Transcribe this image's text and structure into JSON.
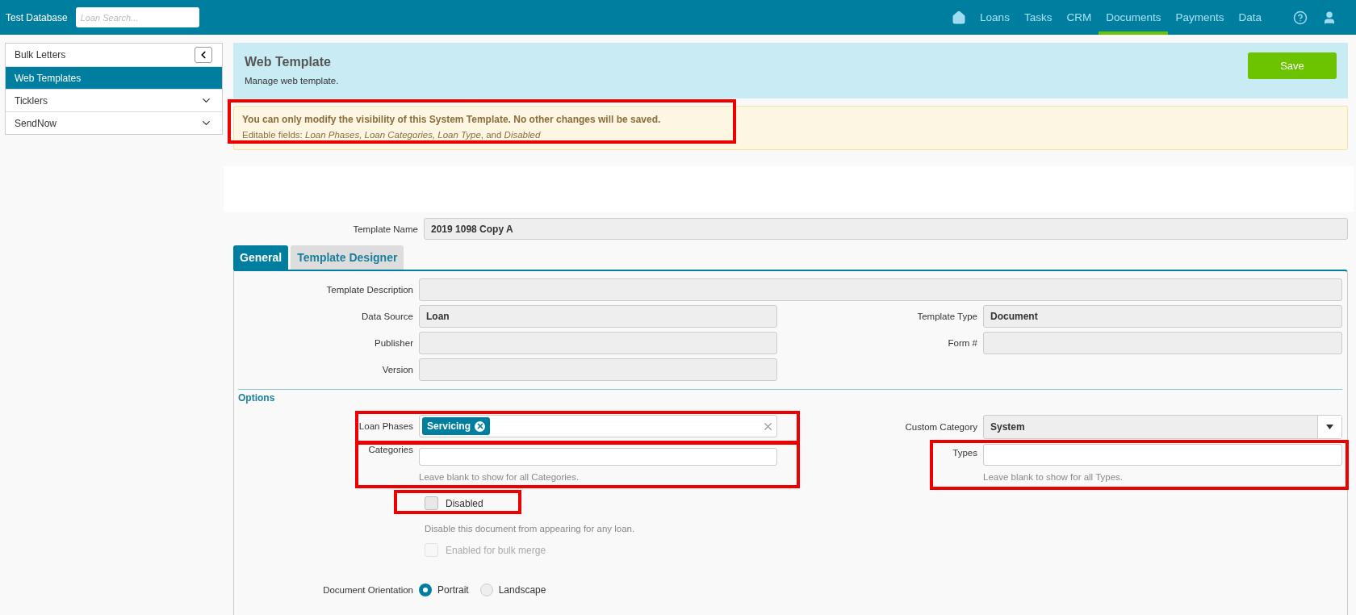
{
  "top_bar": {
    "title": "Test Database",
    "search": {
      "placeholder": "Loan Search..."
    },
    "nav": [
      {
        "label": "Loans",
        "selected": false
      },
      {
        "label": "Tasks",
        "selected": false
      },
      {
        "label": "CRM",
        "selected": false
      },
      {
        "label": "Documents",
        "selected": true
      },
      {
        "label": "Payments",
        "selected": false
      },
      {
        "label": "Data",
        "selected": false
      }
    ]
  },
  "sidebar": {
    "items": [
      {
        "label": "Bulk Letters",
        "selected": false,
        "kind": "collapse"
      },
      {
        "label": "Web Templates",
        "selected": true,
        "kind": "plain"
      },
      {
        "label": "Ticklers",
        "selected": false,
        "kind": "expand"
      },
      {
        "label": "SendNow",
        "selected": false,
        "kind": "expand"
      }
    ]
  },
  "header": {
    "title": "Web Template",
    "subtitle": "Manage web template.",
    "save_button": "Save"
  },
  "notice": {
    "title": "You can only modify the visibility of this System Template. No other changes will be saved.",
    "text": "Editable fields: *Loan Phases, Loan Categories, Loan Type*, and *Disabled*",
    "highlighted": true
  },
  "template_name": {
    "label": "Template Name",
    "value": "2019 1098 Copy A"
  },
  "tabs": [
    {
      "label": "General",
      "selected": true
    },
    {
      "label": "Template Designer",
      "selected": false
    }
  ],
  "general": {
    "rows": [
      {
        "kind": "wide",
        "fields": [
          {
            "label": "Template Description"
          }
        ]
      },
      {
        "kind": "pair",
        "fields": [
          {
            "label": "Data Source",
            "value": "Loan"
          },
          {
            "label": "Template Type",
            "value": "Document"
          }
        ]
      },
      {
        "kind": "pair",
        "fields": [
          {
            "label": "Publisher"
          },
          {
            "label": "Form #"
          }
        ]
      },
      {
        "kind": "pair",
        "fields": [
          {
            "label": "Version"
          }
        ]
      }
    ]
  },
  "options": {
    "title": "Options",
    "loan_phases": {
      "label": "Loan Phases",
      "tags": [
        "Servicing"
      ],
      "highlighted": true
    },
    "custom_category": {
      "label": "Custom Category",
      "value": "System"
    },
    "categories": {
      "label": "Categories",
      "help": "Leave blank to show for all Categories.",
      "highlighted": true
    },
    "types": {
      "label": "Types",
      "help": "Leave blank to show for all Types.",
      "highlighted": true
    },
    "checkboxes": [
      {
        "label": "Disabled",
        "checked": false,
        "disabled": false,
        "help": "Disable this document from appearing for any loan.",
        "highlighted": true
      },
      {
        "label": "Enabled for bulk merge",
        "checked": false,
        "disabled": true,
        "highlighted": false
      }
    ],
    "orientation": {
      "label": "Document Orientation",
      "options": [
        {
          "label": "Portrait",
          "selected": true
        },
        {
          "label": "Landscape",
          "selected": false
        }
      ]
    }
  }
}
